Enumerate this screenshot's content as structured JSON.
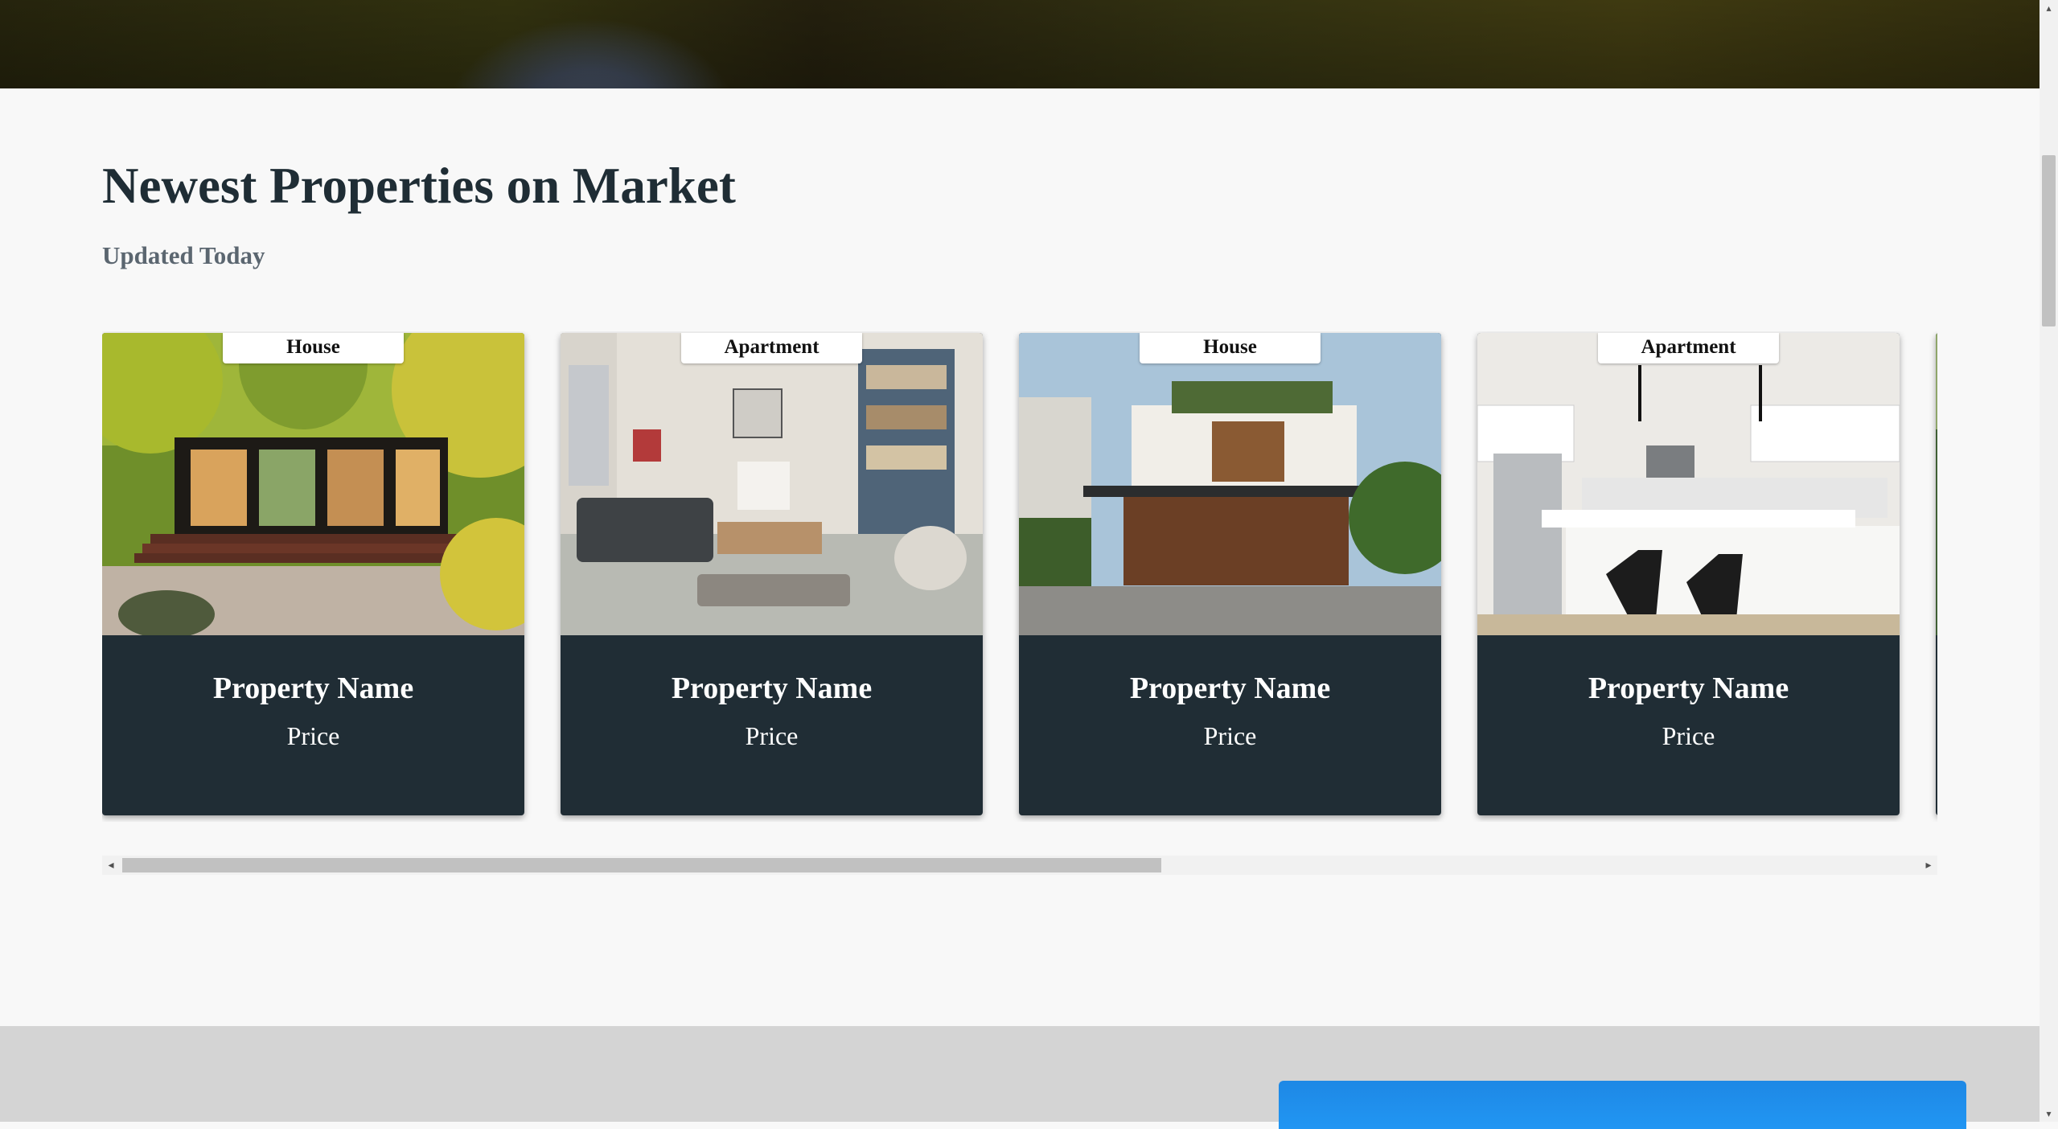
{
  "section": {
    "title": "Newest Properties on Market",
    "subtitle": "Updated Today"
  },
  "listings": [
    {
      "type": "House",
      "name": "Property Name",
      "price": "Price"
    },
    {
      "type": "Apartment",
      "name": "Property Name",
      "price": "Price"
    },
    {
      "type": "House",
      "name": "Property Name",
      "price": "Price"
    },
    {
      "type": "Apartment",
      "name": "Property Name",
      "price": "Price"
    }
  ],
  "colors": {
    "card_bg": "#202d35",
    "title": "#1f2d35",
    "subtitle": "#5b6670",
    "footer_band": "#d4d4d4",
    "accent_blue": "#2196f3"
  },
  "icons": {
    "scroll_left": "triangle-left",
    "scroll_right": "triangle-right",
    "scroll_up": "triangle-up",
    "scroll_down": "triangle-down"
  }
}
